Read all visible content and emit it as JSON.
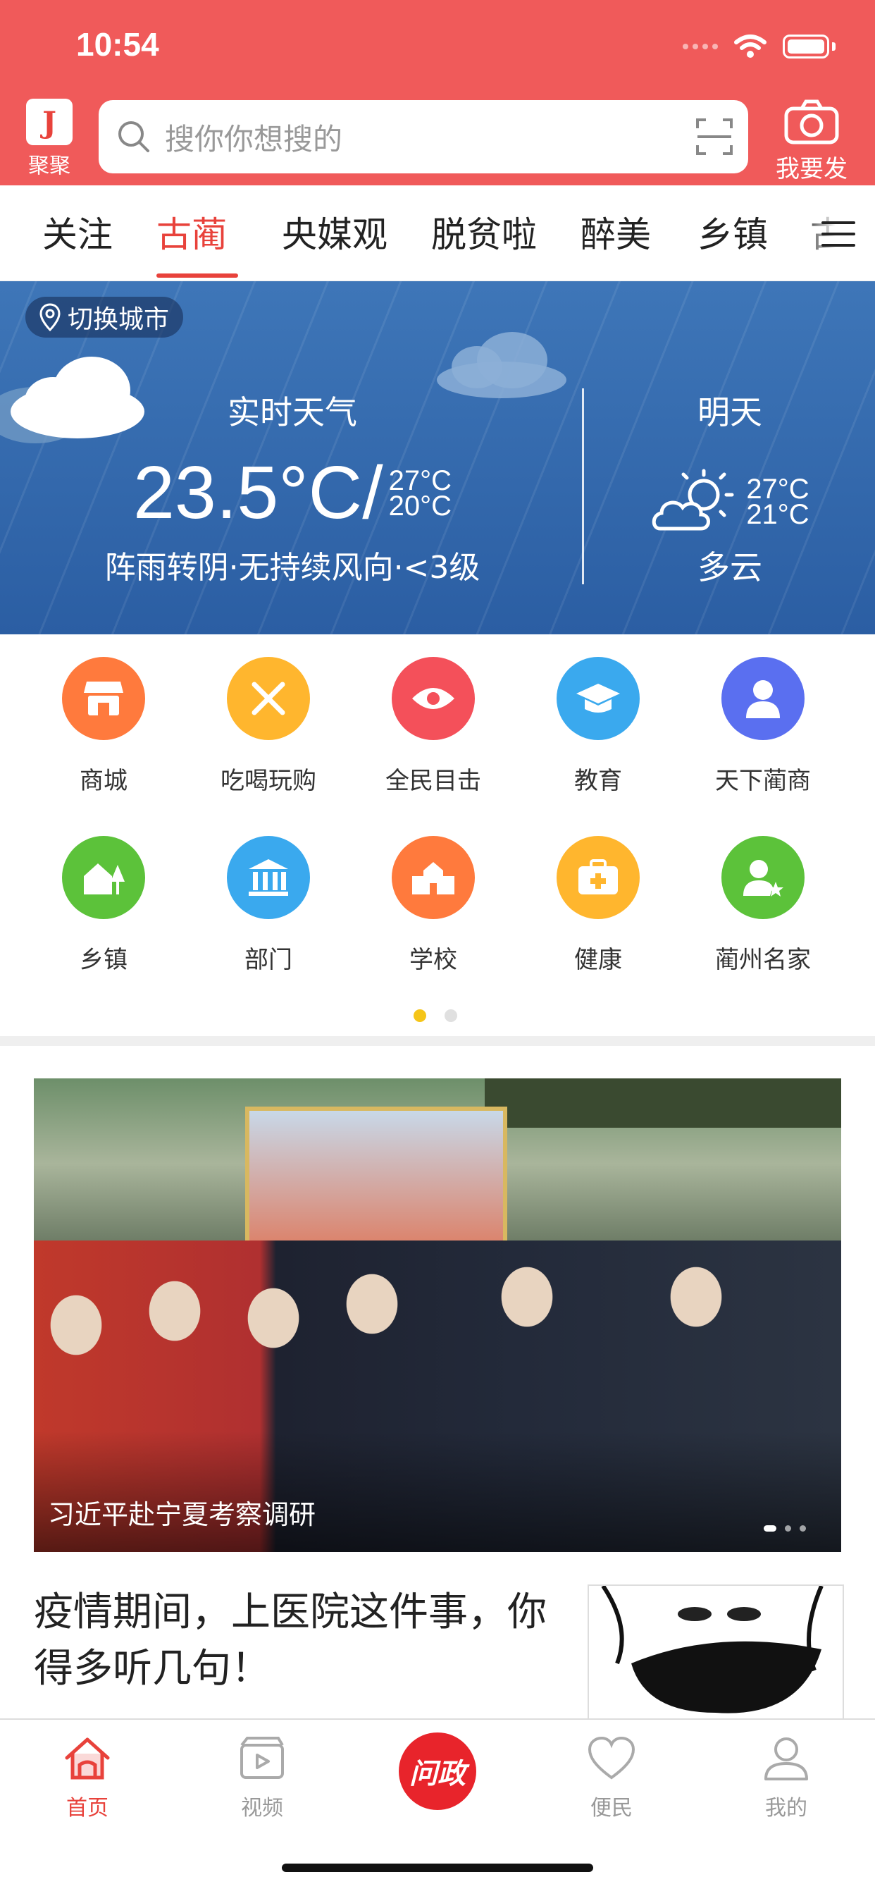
{
  "status_bar": {
    "time": "10:54"
  },
  "header": {
    "logo_label": "聚聚",
    "search_placeholder": "搜你你想搜的",
    "publish_label": "我要发"
  },
  "tabs": [
    {
      "label": "关注"
    },
    {
      "label": "古蔺",
      "active": true
    },
    {
      "label": "央媒观"
    },
    {
      "label": "脱贫啦"
    },
    {
      "label": "醉美"
    },
    {
      "label": "乡镇"
    },
    {
      "label": "古"
    }
  ],
  "weather": {
    "switch_city": "切换城市",
    "live_label": "实时天气",
    "current_temp": "23.5°C/",
    "today_high": "27°C",
    "today_low": "20°C",
    "live_desc": "阵雨转阴·无持续风向·<3级",
    "tomorrow_label": "明天",
    "tomorrow_high": "27°C",
    "tomorrow_low": "21°C",
    "tomorrow_desc": "多云"
  },
  "shortcuts": [
    {
      "label": "商城",
      "icon": "shop-icon",
      "color": "#ff7a3d"
    },
    {
      "label": "吃喝玩购",
      "icon": "utensils-icon",
      "color": "#ffb62e"
    },
    {
      "label": "全民目击",
      "icon": "eye-icon",
      "color": "#f4505a"
    },
    {
      "label": "教育",
      "icon": "graduation-cap-icon",
      "color": "#3aa9ee"
    },
    {
      "label": "天下蔺商",
      "icon": "person-icon",
      "color": "#5a6ff0"
    },
    {
      "label": "乡镇",
      "icon": "house-tree-icon",
      "color": "#5cc23a"
    },
    {
      "label": "部门",
      "icon": "government-building-icon",
      "color": "#3aa9ee"
    },
    {
      "label": "学校",
      "icon": "school-icon",
      "color": "#ff7a3d"
    },
    {
      "label": "健康",
      "icon": "medical-kit-icon",
      "color": "#ffb62e"
    },
    {
      "label": "蔺州名家",
      "icon": "user-star-icon",
      "color": "#5cc23a"
    }
  ],
  "banner": {
    "caption": "习近平赴宁夏考察调研"
  },
  "article": {
    "title": "疫情期间，上医院这件事，你得多听几句！"
  },
  "bottom_nav": [
    {
      "label": "首页",
      "icon": "home-icon",
      "active": true
    },
    {
      "label": "视频",
      "icon": "video-icon"
    },
    {
      "label": "问政",
      "icon": "ask-politics-icon"
    },
    {
      "label": "便民",
      "icon": "heart-icon"
    },
    {
      "label": "我的",
      "icon": "profile-icon"
    }
  ],
  "colors": {
    "brand_red": "#f05a5a",
    "active_red": "#e8423b",
    "weather_blue": "#2f65a8",
    "pager_active": "#f5c518"
  }
}
